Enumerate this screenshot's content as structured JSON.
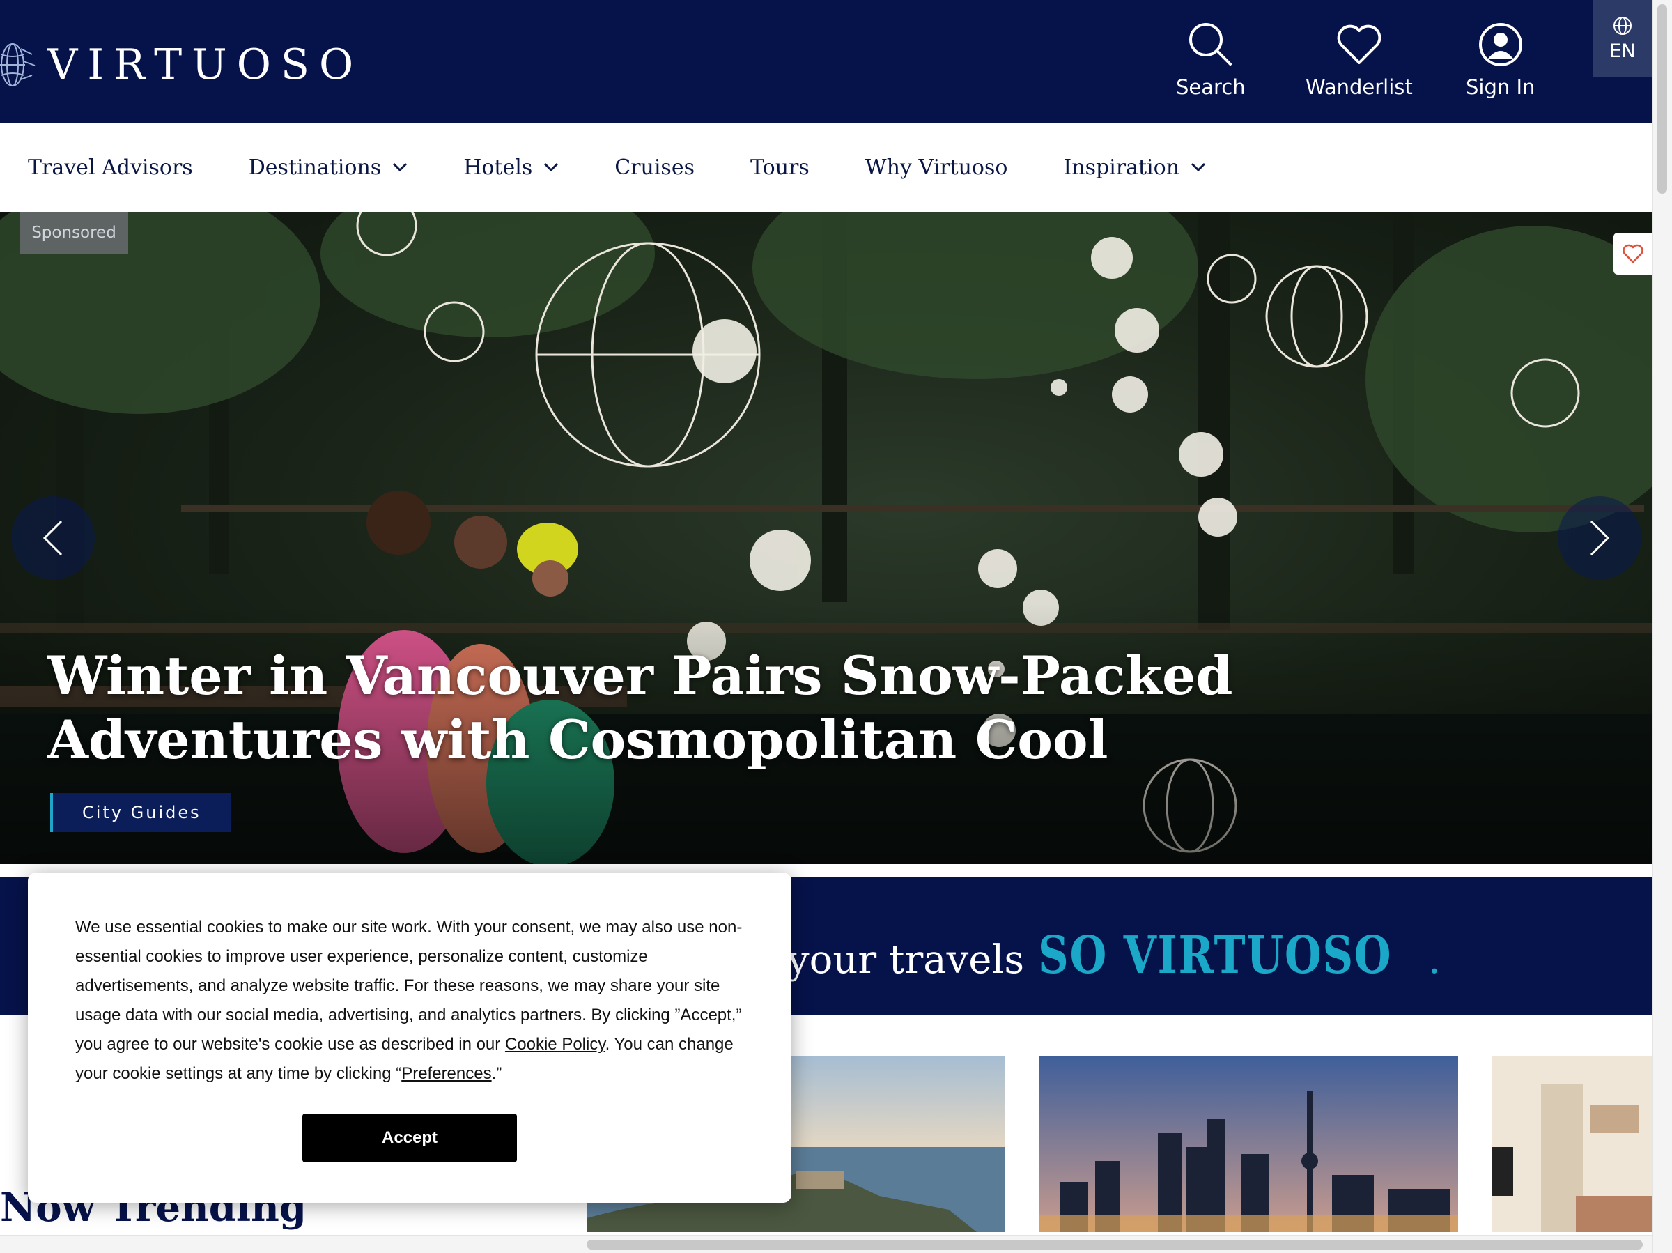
{
  "header": {
    "brand": "VIRTUOSO",
    "brand_mark": "r",
    "actions": [
      {
        "label": "Search",
        "icon": "search-icon"
      },
      {
        "label": "Wanderlist",
        "icon": "heart-icon"
      },
      {
        "label": "Sign In",
        "icon": "user-icon"
      }
    ],
    "language": "EN"
  },
  "nav": {
    "items": [
      {
        "label": "Travel Advisors",
        "dropdown": false
      },
      {
        "label": "Destinations",
        "dropdown": true
      },
      {
        "label": "Hotels",
        "dropdown": true
      },
      {
        "label": "Cruises",
        "dropdown": false
      },
      {
        "label": "Tours",
        "dropdown": false
      },
      {
        "label": "Why Virtuoso",
        "dropdown": false
      },
      {
        "label": "Inspiration",
        "dropdown": true
      }
    ]
  },
  "hero": {
    "badge": "Sponsored",
    "title": "Winter in Vancouver Pairs Snow-Packed Adventures with Cosmopolitan Cool",
    "tag": "City Guides",
    "prev_icon": "chevron-left-icon",
    "next_icon": "chevron-right-icon",
    "save_icon": "heart-icon"
  },
  "band": {
    "lead": "your travels",
    "accent": "SO VIRTUOSO",
    "punct": "."
  },
  "trending": {
    "title": "Now Trending"
  },
  "cookie": {
    "text_1": "We use essential cookies to make our site work. With your consent, we may also use non-essential cookies to improve user experience, personalize content, customize advertisements, and analyze website traffic. For these reasons, we may share your site usage data with our social media, advertising, and analytics partners. By clicking ”Accept,” you agree to our website's cookie use as described in our ",
    "policy_link": "Cookie Policy",
    "text_2": ". You can change your cookie settings at any time by clicking “",
    "preferences_link": "Preferences",
    "text_3": ".”",
    "accept_label": "Accept"
  },
  "colors": {
    "navy": "#06124a",
    "accent_teal": "#1ba7c7",
    "tag_bar": "#1fa5c9",
    "heart_red": "#e0503a"
  }
}
